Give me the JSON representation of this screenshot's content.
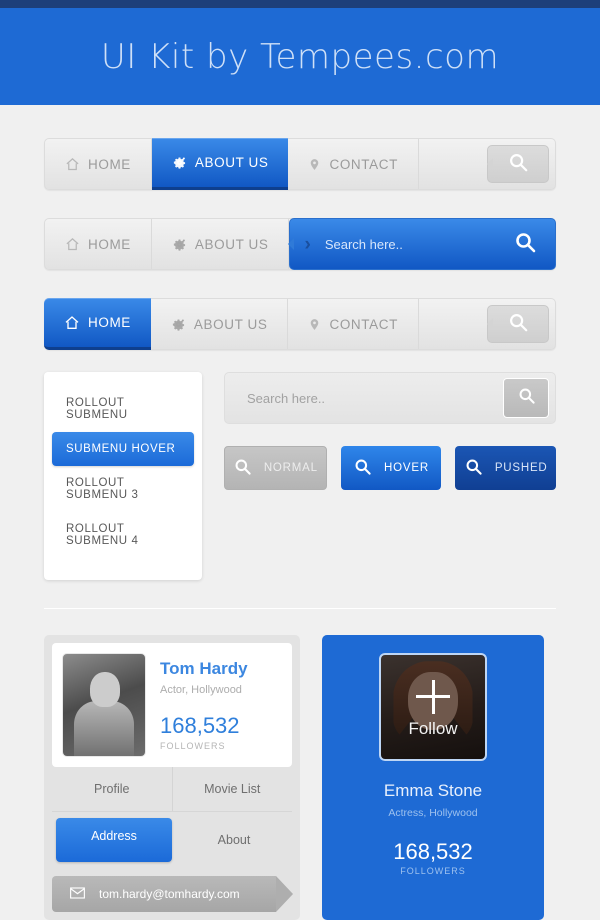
{
  "header": {
    "title": "UI Kit by Tempees.com"
  },
  "nav1": {
    "items": [
      {
        "label": "HOME",
        "icon": "home-icon",
        "active": false
      },
      {
        "label": "ABOUT US",
        "icon": "gear-icon",
        "active": true
      },
      {
        "label": "CONTACT",
        "icon": "pin-icon",
        "active": false
      }
    ],
    "search_icon": "search-icon"
  },
  "nav2": {
    "items": [
      {
        "label": "HOME",
        "icon": "home-icon",
        "active": false
      },
      {
        "label": "ABOUT US",
        "icon": "gear-icon",
        "active": false
      }
    ],
    "search_placeholder": "Search here..",
    "chevron": "›",
    "search_icon": "search-icon"
  },
  "nav3": {
    "items": [
      {
        "label": "HOME",
        "icon": "home-icon",
        "active": true
      },
      {
        "label": "ABOUT US",
        "icon": "gear-icon",
        "active": false
      },
      {
        "label": "CONTACT",
        "icon": "pin-icon",
        "active": false
      }
    ],
    "search_icon": "search-icon"
  },
  "submenu": {
    "items": [
      {
        "label": "ROLLOUT SUBMENU",
        "active": false
      },
      {
        "label": "SUBMENU HOVER",
        "active": true
      },
      {
        "label": "ROLLOUT SUBMENU 3",
        "active": false
      },
      {
        "label": "ROLLOUT SUBMENU 4",
        "active": false
      }
    ]
  },
  "searchfield": {
    "placeholder": "Search here..",
    "icon": "search-icon"
  },
  "buttons": [
    {
      "label": "NORMAL",
      "state": "normal",
      "icon": "search-icon"
    },
    {
      "label": "HOVER",
      "state": "hover",
      "icon": "search-icon"
    },
    {
      "label": "PUSHED",
      "state": "pushed",
      "icon": "search-icon"
    }
  ],
  "profile_card": {
    "name": "Tom Hardy",
    "role": "Actor, Hollywood",
    "followers_count": "168,532",
    "followers_label": "FOLLOWERS",
    "tabs": [
      {
        "label": "Profile",
        "active": false
      },
      {
        "label": "Movie List",
        "active": false
      },
      {
        "label": "Address",
        "active": true
      },
      {
        "label": "About",
        "active": false
      }
    ],
    "email": "tom.hardy@tomhardy.com",
    "email_icon": "envelope-icon"
  },
  "follow_card": {
    "name": "Emma Stone",
    "role": "Actress, Hollywood",
    "followers_count": "168,532",
    "followers_label": "FOLLOWERS",
    "follow_label": "Follow",
    "plus_icon": "plus-icon"
  },
  "colors": {
    "brand_blue": "#1e6ad4",
    "dark_blue": "#1d3f7a",
    "page_bg": "#f0f0f0",
    "muted_text": "#9b9b9b"
  }
}
